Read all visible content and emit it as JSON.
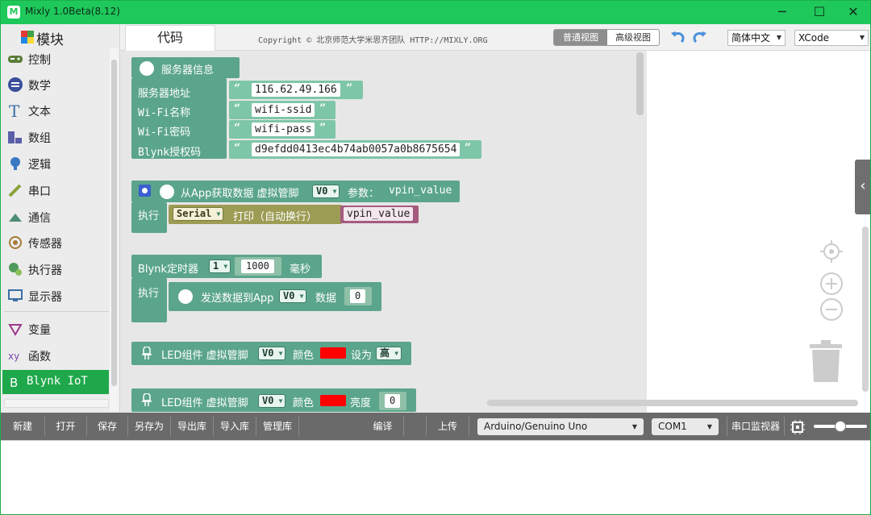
{
  "window": {
    "title": "Mixly 1.0Beta(8.12)",
    "minimize": "─",
    "maximize": "☐",
    "close": "✕"
  },
  "sidebar": {
    "header": "模块",
    "items": [
      {
        "label": "控制",
        "icon": "gamepad-icon"
      },
      {
        "label": "数学",
        "icon": "math-icon"
      },
      {
        "label": "文本",
        "icon": "text-icon"
      },
      {
        "label": "数组",
        "icon": "array-icon"
      },
      {
        "label": "逻辑",
        "icon": "bulb-icon"
      },
      {
        "label": "串口",
        "icon": "serial-icon"
      },
      {
        "label": "通信",
        "icon": "communication-icon"
      },
      {
        "label": "传感器",
        "icon": "sensor-icon"
      },
      {
        "label": "执行器",
        "icon": "actuator-icon"
      },
      {
        "label": "显示器",
        "icon": "monitor-icon"
      },
      {
        "label": "变量",
        "icon": "variable-icon"
      },
      {
        "label": "函数",
        "icon": "function-icon"
      },
      {
        "label": "Blynk IoT",
        "icon": "blynk-icon"
      }
    ]
  },
  "topbar": {
    "code_tab": "代码",
    "copyright": "Copyright © 北京师范大学米思齐团队 HTTP://MIXLY.ORG",
    "view_normal": "普通视图",
    "view_advanced": "高级视图",
    "language": "简体中文",
    "theme": "XCode"
  },
  "blocks": {
    "server": {
      "title": "服务器信息",
      "addr_label": "服务器地址",
      "addr_value": "116.62.49.166",
      "ssid_label": "Wi-Fi名称",
      "ssid_value": "wifi-ssid",
      "pass_label": "Wi-Fi密码",
      "pass_value": "wifi-pass",
      "auth_label": "Blynk授权码",
      "auth_value": "d9efdd0413ec4b74ab0057a0b8675654"
    },
    "app_read": {
      "title": "从App获取数据 虚拟管脚",
      "pin": "V0",
      "param_label": "参数：",
      "param_value": "vpin_value",
      "exec_label": "执行",
      "serial": "Serial",
      "print_label": "打印（自动换行）",
      "print_value": "vpin_value"
    },
    "timer": {
      "title": "Blynk定时器",
      "index": "1",
      "interval": "1000",
      "unit": "毫秒",
      "exec_label": "执行",
      "send_label": "发送数据到App",
      "pin": "V0",
      "data_label": "数据",
      "data_value": "0"
    },
    "led1": {
      "title": "LED组件 虚拟管脚",
      "pin": "V0",
      "color_label": "颜色",
      "color": "#ff0000",
      "set_label": "设为",
      "state": "高"
    },
    "led2": {
      "title": "LED组件 虚拟管脚",
      "pin": "V0",
      "color_label": "颜色",
      "color": "#ff0000",
      "brightness_label": "亮度",
      "brightness": "0"
    }
  },
  "bottombar": {
    "new": "新建",
    "open": "打开",
    "save": "保存",
    "save_as": "另存为",
    "export_lib": "导出库",
    "import_lib": "导入库",
    "manage_lib": "管理库",
    "compile": "编译",
    "upload": "上传",
    "board": "Arduino/Genuino Uno",
    "port": "COM1",
    "serial_monitor": "串口监视器"
  },
  "colors": {
    "titlebar": "#1fc85b",
    "block": "#5ba58c",
    "active_category": "#1fa84b"
  }
}
